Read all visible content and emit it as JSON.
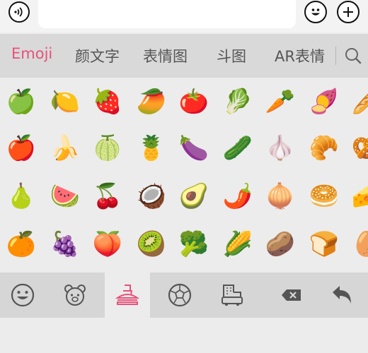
{
  "input": {
    "value": ""
  },
  "tabs": [
    {
      "label": "Emoji",
      "active": true
    },
    {
      "label": "颜文字",
      "active": false
    },
    {
      "label": "表情图",
      "active": false
    },
    {
      "label": "斗图",
      "active": false
    },
    {
      "label": "AR表情",
      "active": false
    }
  ],
  "accent_color": "#e8517a",
  "emoji_rows": [
    [
      "🍏",
      "🍋",
      "🍓",
      "🥭",
      "🍅",
      "🥬",
      "🥕",
      "🍠",
      "🥖"
    ],
    [
      "🍎",
      "🍌",
      "🍈",
      "🍍",
      "🍆",
      "🥒",
      "🧄",
      "🥐",
      "🥨"
    ],
    [
      "🍐",
      "🍉",
      "🍒",
      "🥥",
      "🥑",
      "🌶️",
      "🧅",
      "🥯",
      "🧀"
    ],
    [
      "🍊",
      "🍇",
      "🍑",
      "🥝",
      "🥦",
      "🌽",
      "🥔",
      "🍞",
      "🥚"
    ]
  ],
  "icons": {
    "voice": "voice-icon",
    "emoji": "smiley-icon",
    "plus": "plus-icon",
    "search": "search-icon",
    "smileys_category": "smiley-category-icon",
    "animals_category": "bear-icon",
    "food_category": "burger-drink-icon",
    "activity_category": "soccer-ball-icon",
    "travel_category": "building-car-icon",
    "backspace": "backspace-icon",
    "undo": "undo-arrow-icon"
  }
}
